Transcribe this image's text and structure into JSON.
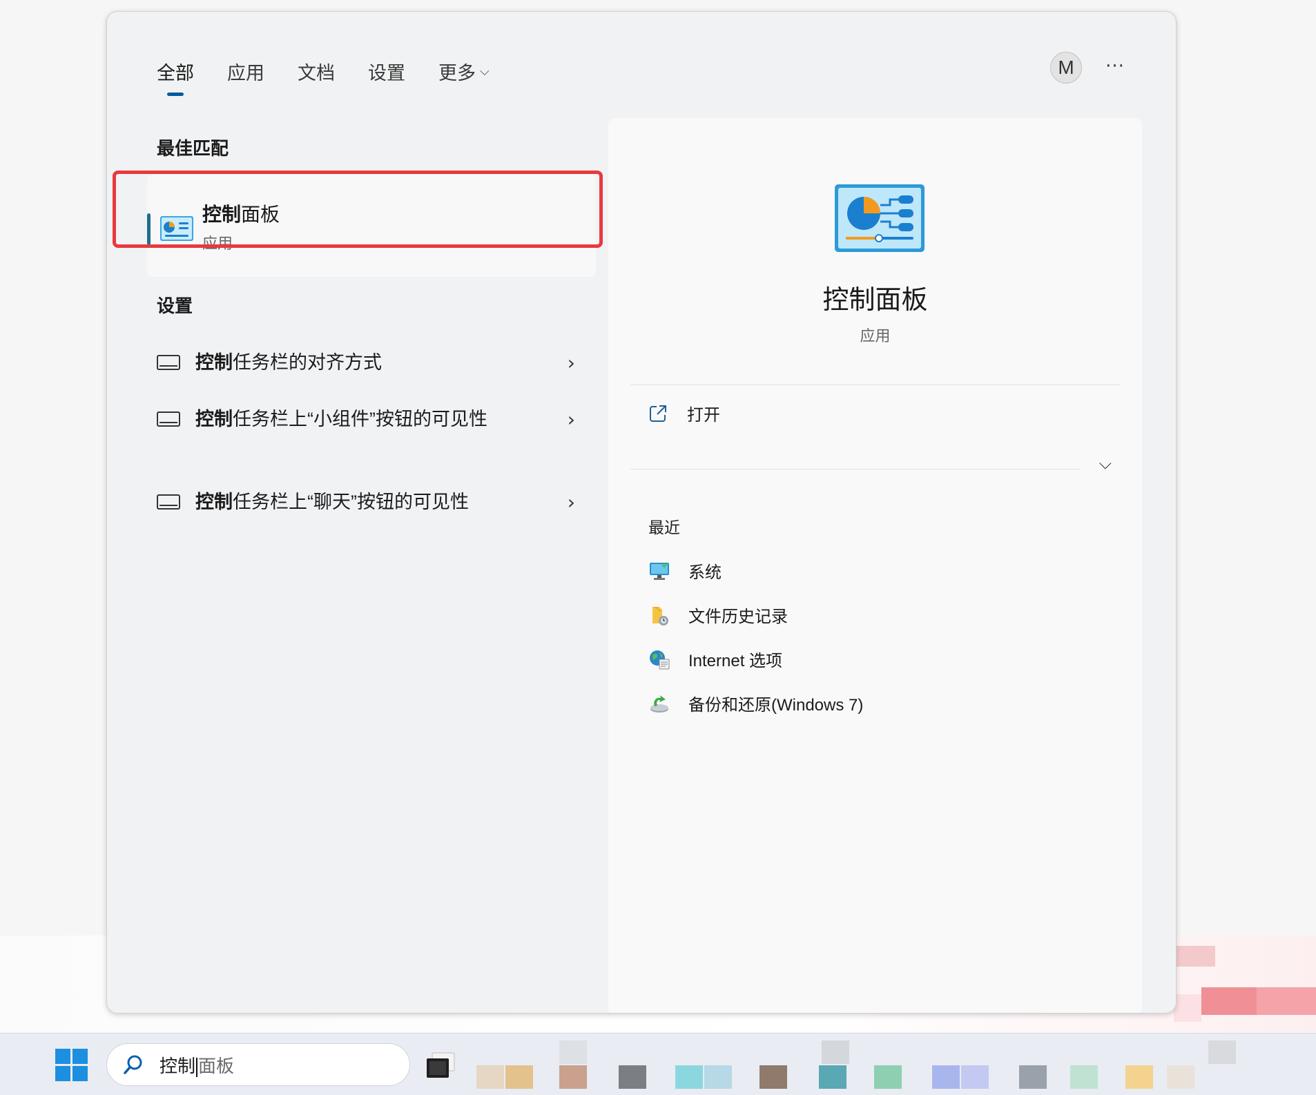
{
  "panel": {
    "tabs": [
      {
        "label": "全部",
        "active": true
      },
      {
        "label": "应用"
      },
      {
        "label": "文档"
      },
      {
        "label": "设置"
      },
      {
        "label": "更多"
      }
    ],
    "avatar_initial": "M",
    "more_options": "···"
  },
  "best_match": {
    "section_title": "最佳匹配",
    "name_bold": "控制",
    "name_rest": "面板",
    "type": "应用"
  },
  "settings": {
    "section_title": "设置",
    "items": [
      {
        "bold": "控制",
        "rest": "任务栏的对齐方式"
      },
      {
        "bold": "控制",
        "rest": "任务栏上“小组件”按钮的可见性"
      },
      {
        "bold": "控制",
        "rest": "任务栏上“聊天”按钮的可见性"
      }
    ]
  },
  "detail": {
    "title": "控制面板",
    "type": "应用",
    "open_label": "打开",
    "recent_title": "最近",
    "recent": [
      {
        "label": "系统",
        "icon": "system-monitor-icon"
      },
      {
        "label": "文件历史记录",
        "icon": "file-history-icon"
      },
      {
        "label": "Internet 选项",
        "icon": "internet-options-icon"
      },
      {
        "label": "备份和还原(Windows 7)",
        "icon": "backup-restore-icon"
      }
    ]
  },
  "taskbar": {
    "search_typed": "控制",
    "search_hint": "面板"
  },
  "colors": {
    "highlight": "#e8393e",
    "tab_indicator": "#005a9e",
    "windows_blue": "#1d8fe0"
  }
}
